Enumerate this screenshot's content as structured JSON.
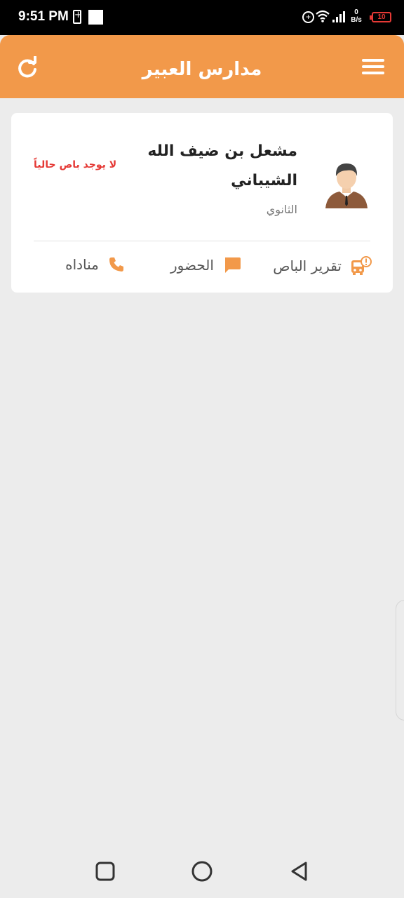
{
  "status_bar": {
    "time": "9:51 PM",
    "speed_value": "0",
    "speed_unit": "B/s",
    "battery_level": "10",
    "icons": [
      "battery-charging-icon",
      "notification-square-icon",
      "add-circle-icon",
      "wifi-icon",
      "signal-icon",
      "battery-icon"
    ]
  },
  "app_bar": {
    "title": "مدارس العبير",
    "refresh_icon": "refresh-icon",
    "menu_icon": "menu-icon",
    "color": "#f2994a"
  },
  "student_card": {
    "name": "مشعل بن ضيف الله الشيباني",
    "grade": "الثانوي",
    "bus_status": "لا يوجد باص حالياً",
    "bus_status_color": "#e53935",
    "avatar_icon": "student-avatar-icon",
    "actions": [
      {
        "label": "تقرير الباص",
        "icon": "bus-alert-icon"
      },
      {
        "label": "الحضور",
        "icon": "chat-icon"
      },
      {
        "label": "مناداه",
        "icon": "phone-icon"
      }
    ],
    "accent_color": "#f2994a"
  },
  "nav_bar": {
    "icons": [
      "recent-apps-icon",
      "home-icon",
      "back-icon"
    ]
  }
}
